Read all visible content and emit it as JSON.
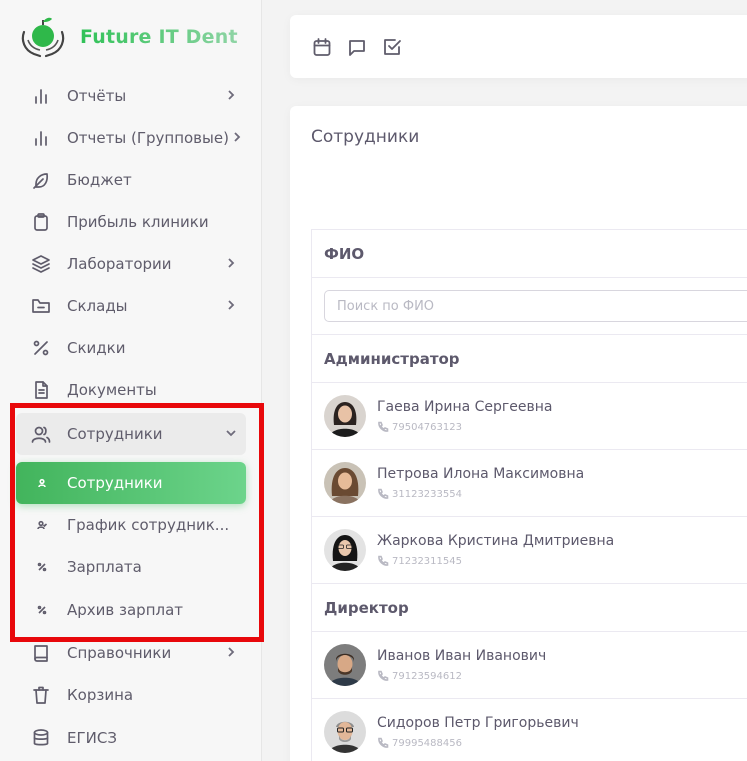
{
  "app": {
    "logo_text": "Future IT Dent"
  },
  "sidebar": {
    "items": [
      {
        "label": "Отчёты",
        "icon": "bar-chart-icon",
        "has_chevron": true
      },
      {
        "label": "Отчеты (Групповые)",
        "icon": "bar-chart-icon",
        "has_chevron": true
      },
      {
        "label": "Бюджет",
        "icon": "feather-icon",
        "has_chevron": false
      },
      {
        "label": "Прибыль клиники",
        "icon": "clipboard-icon",
        "has_chevron": false
      },
      {
        "label": "Лаборатории",
        "icon": "layers-icon",
        "has_chevron": true
      },
      {
        "label": "Склады",
        "icon": "folder-minus-icon",
        "has_chevron": true
      },
      {
        "label": "Скидки",
        "icon": "percent-icon",
        "has_chevron": false
      },
      {
        "label": "Документы",
        "icon": "file-text-icon",
        "has_chevron": false
      },
      {
        "label": "Сотрудники",
        "icon": "users-icon",
        "has_chevron": true,
        "expanded": true
      },
      {
        "label": "Справочники",
        "icon": "book-icon",
        "has_chevron": true
      },
      {
        "label": "Корзина",
        "icon": "trash-icon",
        "has_chevron": false
      },
      {
        "label": "ЕГИСЗ",
        "icon": "database-icon",
        "has_chevron": false
      }
    ],
    "submenu": [
      {
        "label": "Сотрудники",
        "icon": "user-icon",
        "active": true
      },
      {
        "label": "График сотрудник...",
        "icon": "user-check-icon",
        "active": false
      },
      {
        "label": "Зарплата",
        "icon": "percent-icon",
        "active": false
      },
      {
        "label": "Архив зарплат",
        "icon": "percent-icon",
        "active": false
      }
    ]
  },
  "topbar": {
    "icons": [
      "calendar-icon",
      "message-icon",
      "check-square-icon"
    ]
  },
  "main": {
    "title": "Сотрудники",
    "table": {
      "header": "ФИО",
      "search_placeholder": "Поиск по ФИО",
      "groups": [
        {
          "name": "Администратор",
          "people": [
            {
              "name": "Гаева Ирина Сергеевна",
              "phone": "79504763123"
            },
            {
              "name": "Петрова Илона Максимовна",
              "phone": "31123233554"
            },
            {
              "name": "Жаркова Кристина Дмитриевна",
              "phone": "71232311545"
            }
          ]
        },
        {
          "name": "Директор",
          "people": [
            {
              "name": "Иванов Иван Иванович",
              "phone": "79123594612"
            },
            {
              "name": "Сидоров Петр Григорьевич",
              "phone": "79995488456"
            }
          ]
        }
      ]
    }
  },
  "colors": {
    "accent": "#42b45c",
    "highlight_box": "#e8080b"
  }
}
